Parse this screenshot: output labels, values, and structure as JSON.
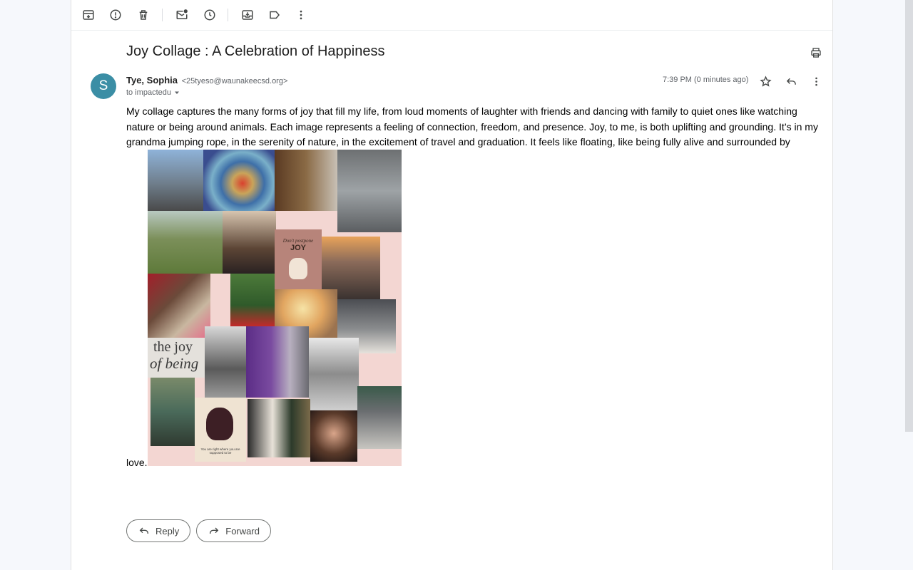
{
  "toolbar": {
    "actions": [
      "archive-icon",
      "report-spam-icon",
      "delete-icon",
      "mark-unread-icon",
      "snooze-icon",
      "move-to-icon",
      "label-icon",
      "more-icon"
    ]
  },
  "message": {
    "subject": "Joy Collage : A Celebration of Happiness",
    "avatar_letter": "S",
    "sender_name": "Tye, Sophia",
    "sender_email": "<25tyeso@waunakeecsd.org>",
    "recipients": "to impactedu",
    "time": "7:39 PM (0 minutes ago)",
    "body": "My collage captures the many forms of joy that fill my life, from loud moments of laughter with friends and dancing with family to quiet ones like watching nature or being around animals. Each image represents a feeling of connection, freedom, and presence. Joy, to me, is both uplifting and grounding. It’s in my grandma jumping rope, in the serenity of nature, in the excitement of travel and graduation. It feels like floating, like being fully alive and surrounded by",
    "closing": "love."
  },
  "collage": {
    "poster_line1": "Don't postpone",
    "poster_word": "JOY",
    "phrase_line1": "the joy",
    "phrase_line2": "of being",
    "cat_caption": "You are right where you are supposed to be"
  },
  "actions": {
    "reply_label": "Reply",
    "forward_label": "Forward"
  },
  "colors": {
    "avatar": "#3b8ea5",
    "background": "#f6f8fc"
  }
}
